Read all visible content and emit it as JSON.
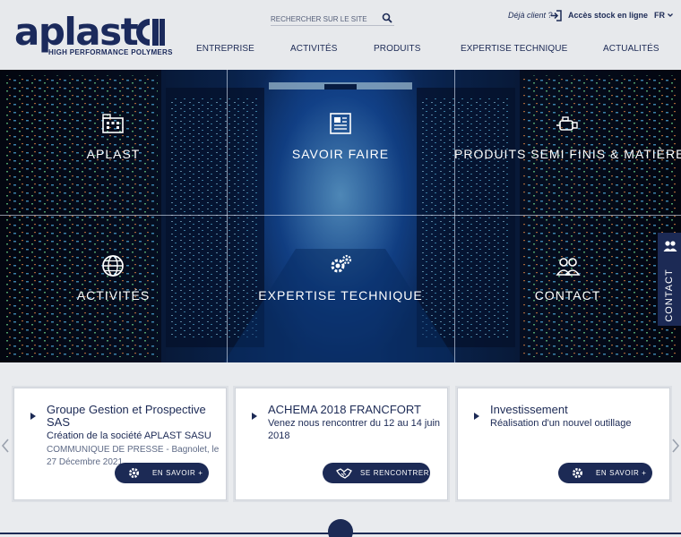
{
  "header": {
    "logo_text": "aplast",
    "logo_tagline": "HIGH PERFORMANCE POLYMERS",
    "search_placeholder": "RECHERCHER SUR LE SITE",
    "client_prompt": "Déjà client ?",
    "stock_link": "Accès stock en ligne",
    "language": "FR"
  },
  "nav": [
    {
      "label": "ENTREPRISE"
    },
    {
      "label": "ACTIVITÉS"
    },
    {
      "label": "PRODUITS"
    },
    {
      "label": "EXPERTISE TECHNIQUE"
    },
    {
      "label": "ACTUALITÉS"
    }
  ],
  "tiles": [
    {
      "label": "APLAST",
      "icon": "building-icon"
    },
    {
      "label": "SAVOIR FAIRE",
      "icon": "document-icon"
    },
    {
      "label": "PRODUITS SEMI FINIS & MATIÈRES",
      "icon": "extruder-icon"
    },
    {
      "label": "ACTIVITÉS",
      "icon": "globe-icon"
    },
    {
      "label": "EXPERTISE TECHNIQUE",
      "icon": "gears-icon"
    },
    {
      "label": "CONTACT",
      "icon": "people-icon"
    }
  ],
  "contact_tab": {
    "label": "CONTACT",
    "icon": "people-icon"
  },
  "news": [
    {
      "title": "Groupe Gestion et Prospective SAS",
      "subtitle": "Création de la société APLAST SASU",
      "description": "COMMUNIQUE DE PRESSE - Bagnolet, le 27 Décembre 2021",
      "button": "EN SAVOIR +",
      "button_icon": "gear-icon"
    },
    {
      "title": "ACHEMA 2018 FRANCFORT",
      "subtitle": "Venez nous rencontrer du 12 au 14 juin 2018",
      "description": "",
      "button": "SE RENCONTRER",
      "button_icon": "handshake-icon"
    },
    {
      "title": "Investissement",
      "subtitle": "Réalisation d'un nouvel outillage",
      "description": "",
      "button": "EN SAVOIR +",
      "button_icon": "gear-icon"
    }
  ],
  "colors": {
    "brand": "#1c2a55",
    "background": "#e9ebee",
    "card": "#ffffff"
  }
}
